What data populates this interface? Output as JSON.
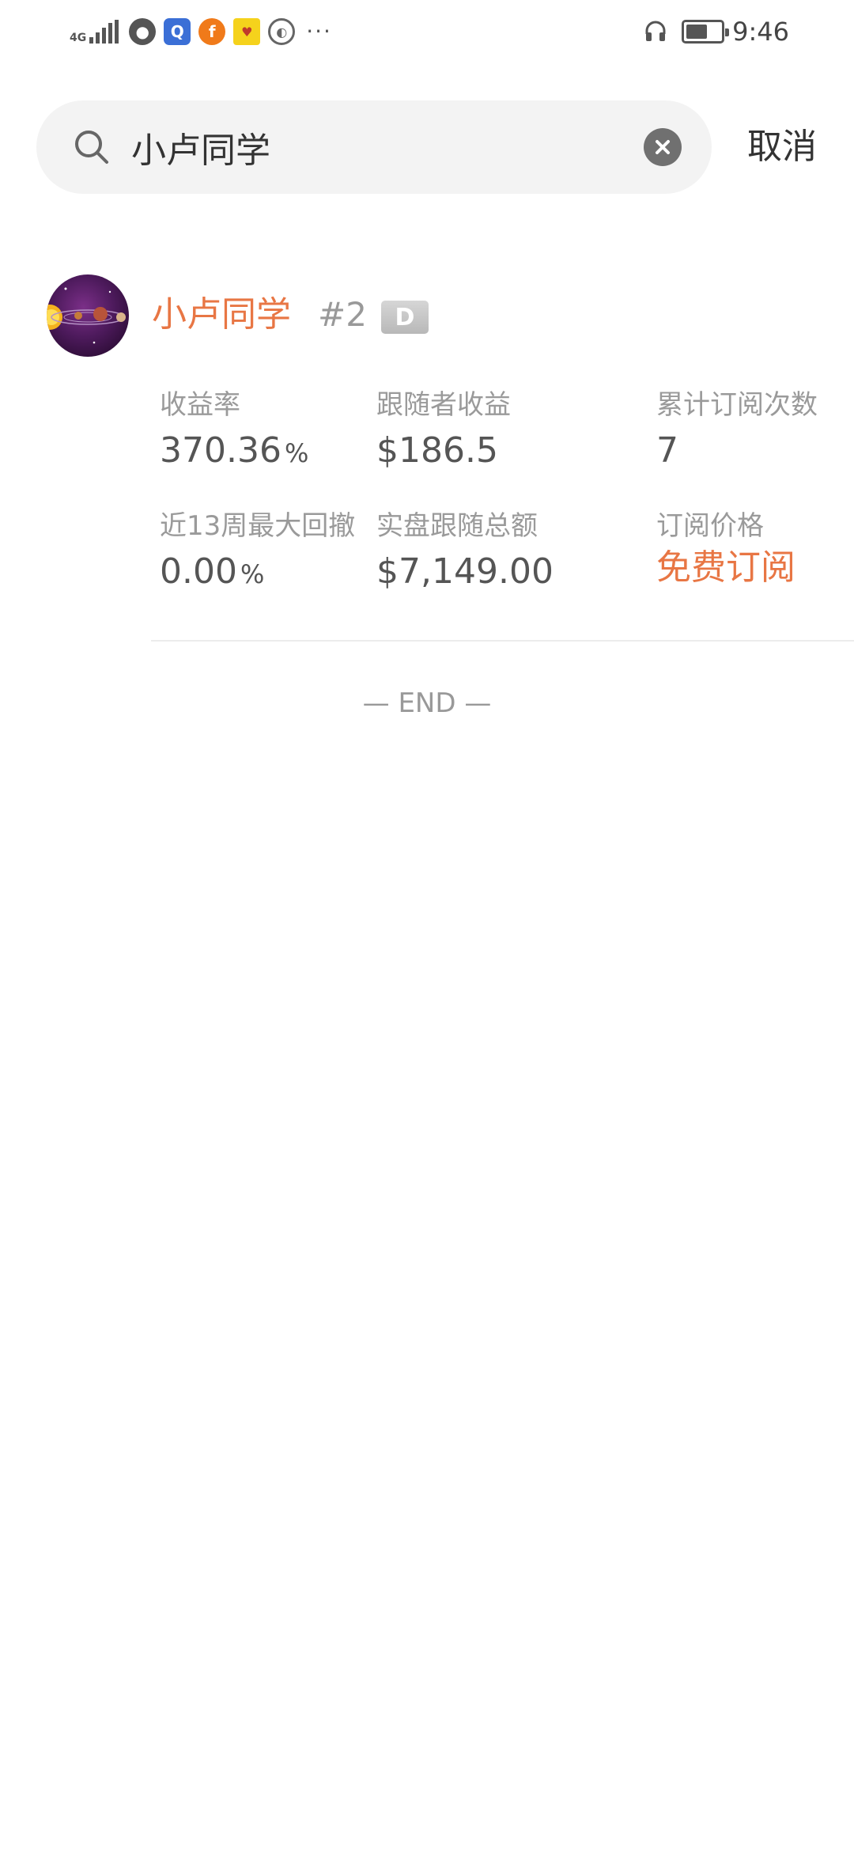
{
  "status_bar": {
    "network_label": "4G",
    "time": "9:46",
    "battery_percent": 45,
    "more_label": "···"
  },
  "search": {
    "query": "小卢同学",
    "cancel_label": "取消"
  },
  "result": {
    "name": "小卢同学",
    "rank": "#2",
    "grade": "D",
    "stats": {
      "return_rate_label": "收益率",
      "return_rate_value": "370.36",
      "return_rate_unit": "%",
      "follower_profit_label": "跟随者收益",
      "follower_profit_value": "$186.5",
      "subscriptions_label": "累计订阅次数",
      "subscriptions_value": "7",
      "drawdown_label": "近13周最大回撤",
      "drawdown_value": "0.00",
      "drawdown_unit": "%",
      "follow_total_label": "实盘跟随总额",
      "follow_total_value": "$7,149.00",
      "price_label": "订阅价格",
      "price_value": "免费订阅"
    }
  },
  "footer": {
    "end_text": "— END —"
  },
  "colors": {
    "accent": "#e87644",
    "search_bg": "#f3f3f3"
  }
}
